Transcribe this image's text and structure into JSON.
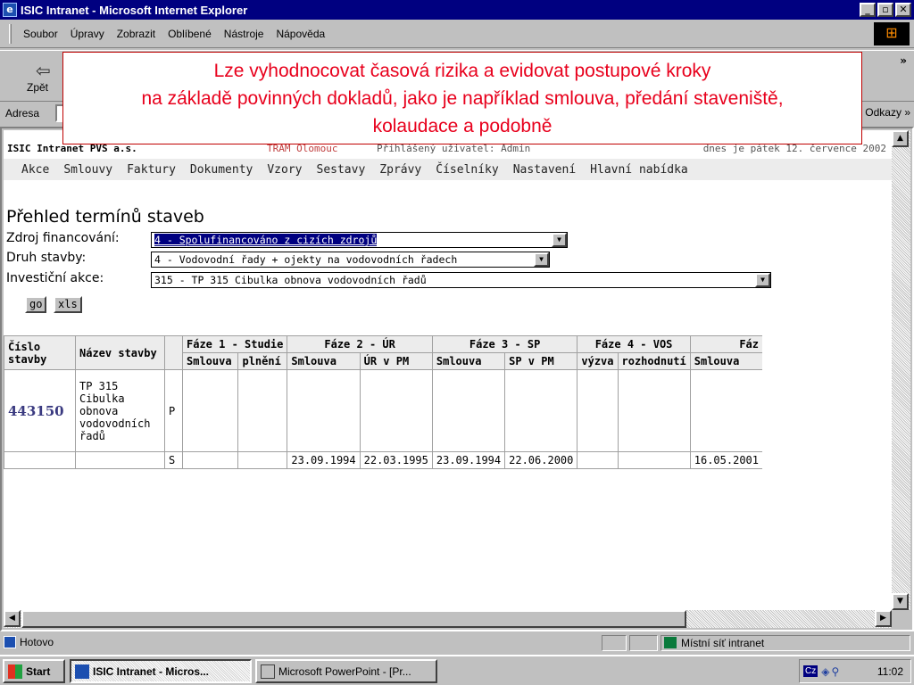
{
  "window": {
    "title": "ISIC Intranet - Microsoft Internet Explorer",
    "buttons": [
      "_",
      "▫",
      "✕"
    ]
  },
  "menu": [
    "Soubor",
    "Úpravy",
    "Zobrazit",
    "Oblíbené",
    "Nástroje",
    "Nápověda"
  ],
  "toolbar": {
    "back_label": "Zpět",
    "more": "»"
  },
  "address": {
    "label": "Adresa",
    "links_label": "Odkazy »"
  },
  "callout": {
    "line1": "Lze vyhodnocovat  časová rizika a evidovat postupové kroky",
    "line2": "na základě povinných dokladů, jako je například smlouva, předání staveniště,",
    "line3": "kolaudace a podobně"
  },
  "site": {
    "brand": "ISIC Intranet PVS a.s.",
    "firm": "TRAM Olomouc",
    "user": "Přihlášený uživatel: Admin",
    "date": "dnes je pátek 12. července 2002"
  },
  "nav": [
    "Akce",
    "Smlouvy",
    "Faktury",
    "Dokumenty",
    "Vzory",
    "Sestavy",
    "Zprávy",
    "Číselníky",
    "Nastavení",
    "Hlavní nabídka"
  ],
  "page": {
    "title": "Přehled termínů staveb",
    "fields": [
      {
        "label": "Zdroj financování:",
        "value": "4 - Spolufinancováno z cizích zdrojů"
      },
      {
        "label": "Druh stavby:",
        "value": "4 - Vodovodní řady + ojekty na vodovodních řadech"
      },
      {
        "label": "Investiční akce:",
        "value": "315 - TP 315 Cibulka obnova vodovodních řadů"
      }
    ],
    "buttons": {
      "go": "go",
      "xls": "xls"
    }
  },
  "table": {
    "col_number": "Číslo stavby",
    "col_name": "Název stavby",
    "phases": [
      "Fáze 1 - Studie",
      "Fáze 2 - ÚR",
      "Fáze 3 - SP",
      "Fáze 4 - VOS",
      "Fáz"
    ],
    "subheaders": [
      "Smlouva",
      "plnění",
      "Smlouva",
      "ÚR v PM",
      "Smlouva",
      "SP v PM",
      "výzva",
      "rozhodnutí",
      "Smlouva"
    ],
    "row_number": "443150",
    "row_name": "TP 315 Cibulka obnova vodovodních řadů",
    "row_p": "P",
    "row_s": "S",
    "s_values": [
      "",
      "",
      "23.09.1994",
      "22.03.1995",
      "23.09.1994",
      "22.06.2000",
      "",
      "",
      "16.05.2001"
    ]
  },
  "status": {
    "text": "Hotovo",
    "zone": "Místní síť intranet"
  },
  "taskbar": {
    "start": "Start",
    "task1": "ISIC Intranet - Micros...",
    "task2": "Microsoft PowerPoint - [Pr...",
    "lang": "Cz",
    "clock": "11:02"
  }
}
